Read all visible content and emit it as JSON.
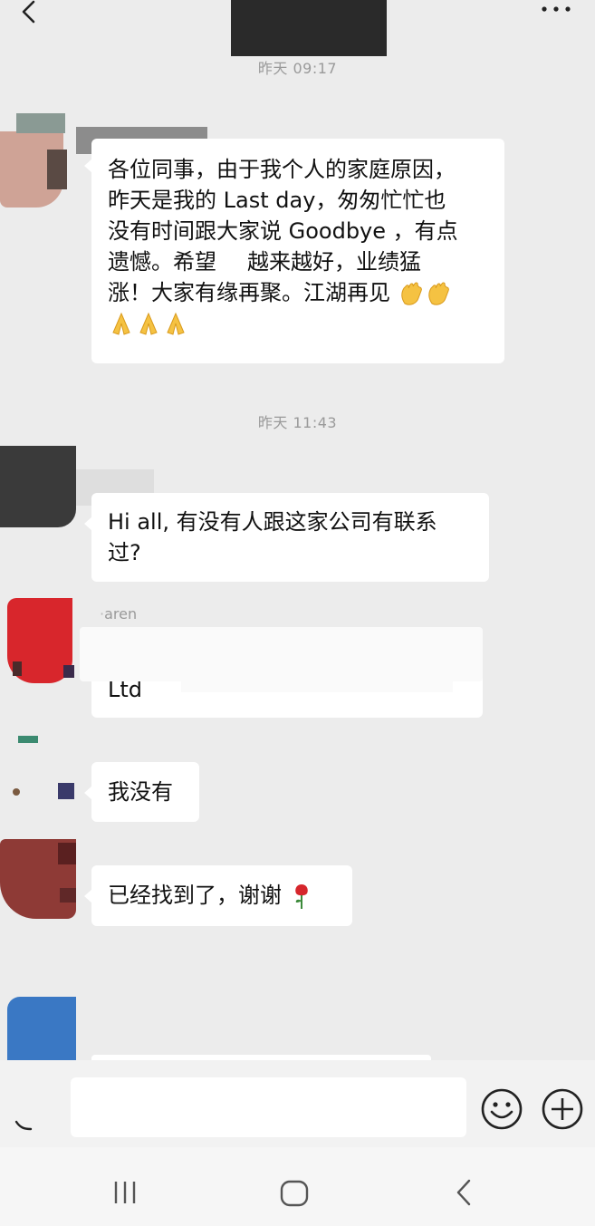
{
  "header": {
    "back_icon": "chevron-left-icon",
    "more_icon": "more-dots-icon"
  },
  "timestamps": [
    "昨天 09:17",
    "昨天 11:43"
  ],
  "messages": [
    {
      "lines": [
        "各位同事，由于我个人的家庭原因，",
        "昨天是我的 Last day，匆匆忙忙也",
        "没有时间跟大家说 Goodbye ，有点",
        "遗憾。希望",
        "越来越好，业绩猛",
        "涨！大家有缘再聚。江湖再见"
      ],
      "emoji_end": "waving-hands",
      "emoji_line": "folded-hands"
    },
    {
      "lines": [
        "Hi all, 有没有人跟这家公司有联系",
        "过?"
      ]
    },
    {
      "sender": "aren",
      "lines": [
        "Ltd"
      ]
    },
    {
      "lines": [
        "我没有"
      ]
    },
    {
      "lines": [
        "已经找到了，谢谢"
      ],
      "emoji_end": "rose"
    }
  ],
  "input": {
    "emoji_icon": "smiley-icon",
    "plus_icon": "plus-circle-icon"
  },
  "nav": {
    "recent_icon": "recent-apps-icon",
    "home_icon": "home-icon",
    "back_icon": "back-icon"
  },
  "colors": {
    "background": "#ececec",
    "bubble": "#ffffff",
    "timestamp": "#9a9a9a"
  }
}
